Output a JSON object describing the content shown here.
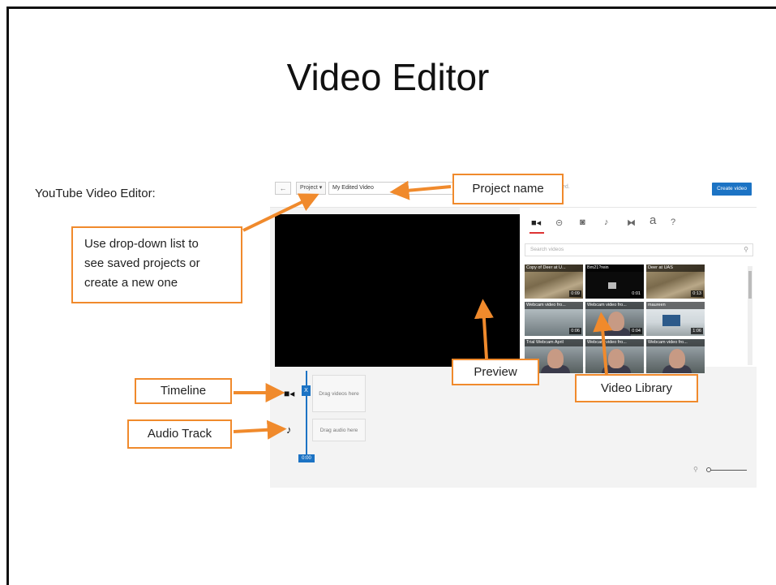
{
  "slide_title": "Video Editor",
  "intro_label": "YouTube Video Editor:",
  "editor": {
    "back_icon": "←",
    "project_button": "Project ▾",
    "project_name_value": "My Edited Video",
    "saved_fragment": "ed.",
    "create_button": "Create video",
    "tools": [
      {
        "icon": "video-camera-icon",
        "glyph": "■◂"
      },
      {
        "icon": "transitions-icon",
        "glyph": "⊝"
      },
      {
        "icon": "photo-icon",
        "glyph": "◙"
      },
      {
        "icon": "music-note-icon",
        "glyph": "♪"
      },
      {
        "icon": "bowtie-icon",
        "glyph": "⧓"
      },
      {
        "icon": "text-icon",
        "glyph": "a"
      },
      {
        "icon": "help-icon",
        "glyph": "?"
      }
    ],
    "search_placeholder": "Search videos",
    "search_icon": "🔍",
    "videos": [
      {
        "title": "Copy of Deer at U...",
        "duration": "0:09",
        "style": "t-deer"
      },
      {
        "title": "Bm21?rein",
        "duration": "0:01",
        "style": "t-dark"
      },
      {
        "title": "Deer at UAS",
        "duration": "0:13",
        "style": "t-deer"
      },
      {
        "title": "Webcam video fro...",
        "duration": "0:06",
        "style": "t-room2"
      },
      {
        "title": "Webcam video fro...",
        "duration": "0:04",
        "style": "t-cam"
      },
      {
        "title": "maureen",
        "duration": "1:06",
        "style": "t-room"
      },
      {
        "title": "Trial Webcam April",
        "duration": "",
        "style": "t-cam"
      },
      {
        "title": "Webcam video fro...",
        "duration": "",
        "style": "t-cam"
      },
      {
        "title": "Webcam video fro...",
        "duration": "",
        "style": "t-cam"
      }
    ],
    "drag_videos": "Drag videos here",
    "drag_audio": "Drag audio here",
    "playhead_time": "0:00",
    "playhead_marker": "X"
  },
  "callouts": {
    "project_name": "Project name",
    "dropdown_help": [
      "Use drop-down list to",
      "see saved projects or",
      "create a new one"
    ],
    "preview": "Preview",
    "video_library": "Video Library",
    "timeline": "Timeline",
    "audio_track": "Audio Track"
  },
  "accent_color": "#f08a2c",
  "create_button_color": "#1c73c4"
}
